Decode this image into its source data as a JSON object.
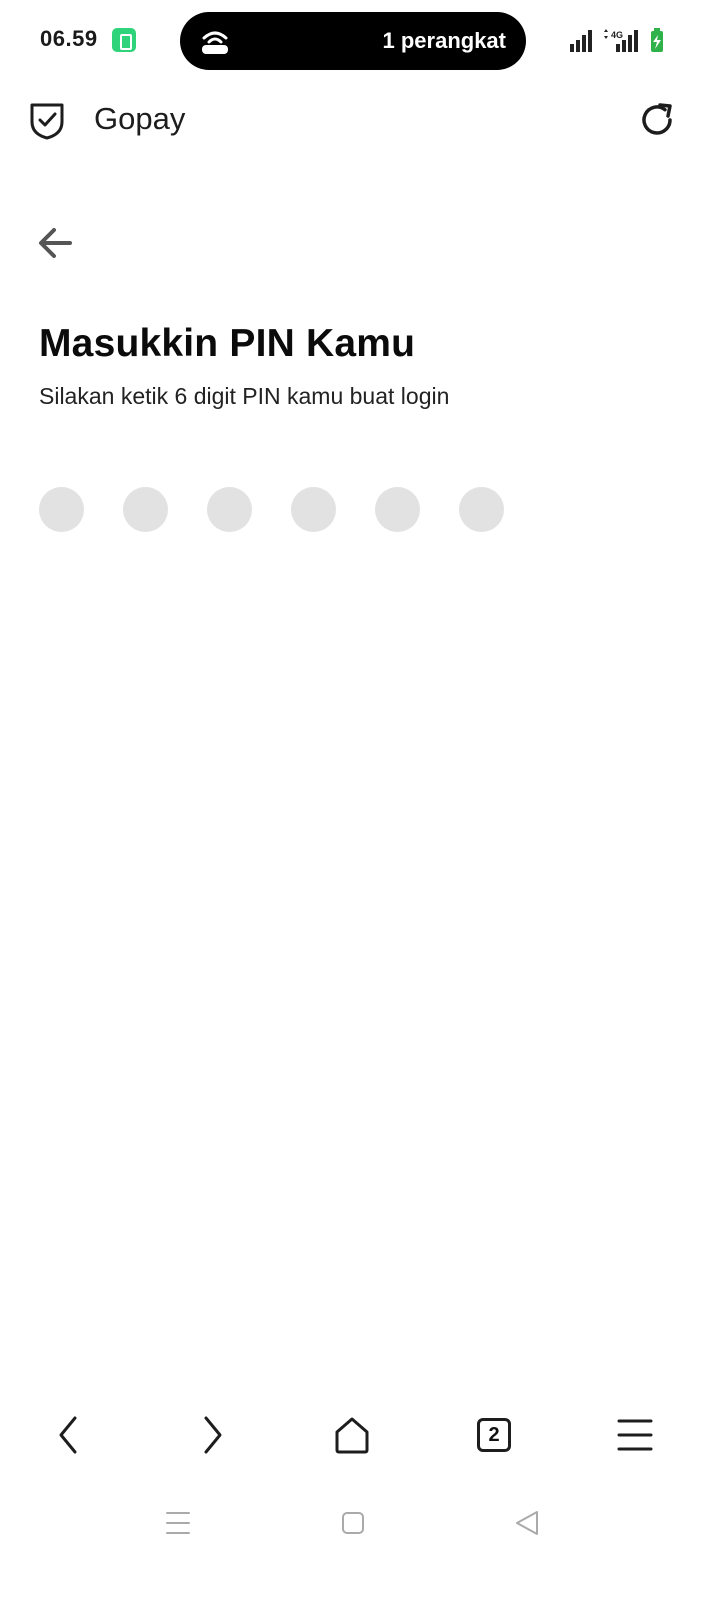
{
  "status_bar": {
    "time": "06.59",
    "hotspot_text": "1 perangkat",
    "network": "4G"
  },
  "browser": {
    "site_title": "Gopay",
    "tab_count": "2"
  },
  "login": {
    "title": "Masukkin PIN Kamu",
    "subtitle": "Silakan ketik 6 digit PIN kamu buat login",
    "pin_digits_entered": 0,
    "pin_length": 6
  },
  "colors": {
    "pin_dot": "#e2e2e2",
    "battery_green": "#2fd37a"
  }
}
